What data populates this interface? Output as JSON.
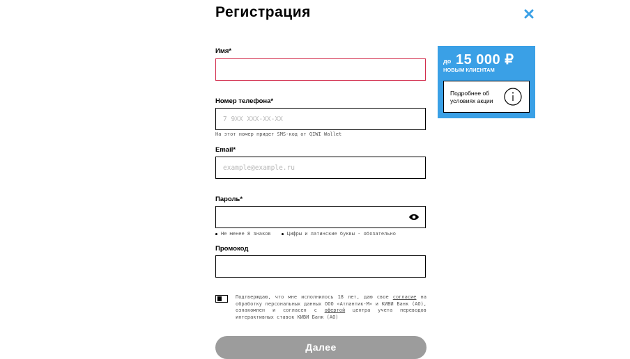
{
  "header": {
    "title": "Регистрация"
  },
  "form": {
    "name": {
      "label": "Имя*",
      "value": "",
      "placeholder": ""
    },
    "phone": {
      "label": "Номер телефона*",
      "value": "",
      "placeholder": "7 9XX XXX-XX-XX",
      "hint": "На этот номер придет SMS-код от QIWI Wallet"
    },
    "email": {
      "label": "Email*",
      "value": "",
      "placeholder": "example@example.ru"
    },
    "password": {
      "label": "Пароль*",
      "value": "",
      "placeholder": "",
      "rules": [
        "Не менее 8 знаков",
        "Цифры и латинские буквы - обязательно"
      ]
    },
    "promo_code": {
      "label": "Промокод",
      "value": "",
      "placeholder": ""
    },
    "consent": {
      "text_1": "Подтверждаю, что мне исполнилось 18 лет, даю свое ",
      "link_1": "согласие",
      "text_2": " на обработку персональных данных ООО «Атлантик-М» и КИВИ Банк (АО), ознакомлен и согласен с ",
      "link_2": "офертой",
      "text_3": " центра учета переводов интерактивных ставок КИВИ Банк (АО)"
    },
    "submit_label": "Далее"
  },
  "promo": {
    "prefix": "до",
    "amount": "15 000 ₽",
    "subtitle": "НОВЫМ КЛИЕНТАМ",
    "details_line1": "Подробнее об",
    "details_line2": "условиях акции"
  },
  "colors": {
    "accent": "#3aa0e6",
    "error": "#d22c4c",
    "button_disabled": "#9c9c9c"
  },
  "icons": {
    "close": "close-icon",
    "eye": "eye-icon",
    "info": "info-icon"
  }
}
